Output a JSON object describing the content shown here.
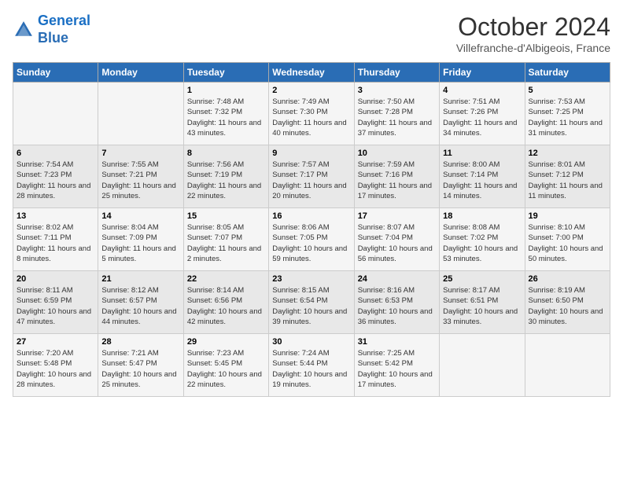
{
  "logo": {
    "line1": "General",
    "line2": "Blue"
  },
  "title": "October 2024",
  "subtitle": "Villefranche-d'Albigeois, France",
  "days_header": [
    "Sunday",
    "Monday",
    "Tuesday",
    "Wednesday",
    "Thursday",
    "Friday",
    "Saturday"
  ],
  "weeks": [
    [
      {
        "day": "",
        "sunrise": "",
        "sunset": "",
        "daylight": ""
      },
      {
        "day": "",
        "sunrise": "",
        "sunset": "",
        "daylight": ""
      },
      {
        "day": "1",
        "sunrise": "Sunrise: 7:48 AM",
        "sunset": "Sunset: 7:32 PM",
        "daylight": "Daylight: 11 hours and 43 minutes."
      },
      {
        "day": "2",
        "sunrise": "Sunrise: 7:49 AM",
        "sunset": "Sunset: 7:30 PM",
        "daylight": "Daylight: 11 hours and 40 minutes."
      },
      {
        "day": "3",
        "sunrise": "Sunrise: 7:50 AM",
        "sunset": "Sunset: 7:28 PM",
        "daylight": "Daylight: 11 hours and 37 minutes."
      },
      {
        "day": "4",
        "sunrise": "Sunrise: 7:51 AM",
        "sunset": "Sunset: 7:26 PM",
        "daylight": "Daylight: 11 hours and 34 minutes."
      },
      {
        "day": "5",
        "sunrise": "Sunrise: 7:53 AM",
        "sunset": "Sunset: 7:25 PM",
        "daylight": "Daylight: 11 hours and 31 minutes."
      }
    ],
    [
      {
        "day": "6",
        "sunrise": "Sunrise: 7:54 AM",
        "sunset": "Sunset: 7:23 PM",
        "daylight": "Daylight: 11 hours and 28 minutes."
      },
      {
        "day": "7",
        "sunrise": "Sunrise: 7:55 AM",
        "sunset": "Sunset: 7:21 PM",
        "daylight": "Daylight: 11 hours and 25 minutes."
      },
      {
        "day": "8",
        "sunrise": "Sunrise: 7:56 AM",
        "sunset": "Sunset: 7:19 PM",
        "daylight": "Daylight: 11 hours and 22 minutes."
      },
      {
        "day": "9",
        "sunrise": "Sunrise: 7:57 AM",
        "sunset": "Sunset: 7:17 PM",
        "daylight": "Daylight: 11 hours and 20 minutes."
      },
      {
        "day": "10",
        "sunrise": "Sunrise: 7:59 AM",
        "sunset": "Sunset: 7:16 PM",
        "daylight": "Daylight: 11 hours and 17 minutes."
      },
      {
        "day": "11",
        "sunrise": "Sunrise: 8:00 AM",
        "sunset": "Sunset: 7:14 PM",
        "daylight": "Daylight: 11 hours and 14 minutes."
      },
      {
        "day": "12",
        "sunrise": "Sunrise: 8:01 AM",
        "sunset": "Sunset: 7:12 PM",
        "daylight": "Daylight: 11 hours and 11 minutes."
      }
    ],
    [
      {
        "day": "13",
        "sunrise": "Sunrise: 8:02 AM",
        "sunset": "Sunset: 7:11 PM",
        "daylight": "Daylight: 11 hours and 8 minutes."
      },
      {
        "day": "14",
        "sunrise": "Sunrise: 8:04 AM",
        "sunset": "Sunset: 7:09 PM",
        "daylight": "Daylight: 11 hours and 5 minutes."
      },
      {
        "day": "15",
        "sunrise": "Sunrise: 8:05 AM",
        "sunset": "Sunset: 7:07 PM",
        "daylight": "Daylight: 11 hours and 2 minutes."
      },
      {
        "day": "16",
        "sunrise": "Sunrise: 8:06 AM",
        "sunset": "Sunset: 7:05 PM",
        "daylight": "Daylight: 10 hours and 59 minutes."
      },
      {
        "day": "17",
        "sunrise": "Sunrise: 8:07 AM",
        "sunset": "Sunset: 7:04 PM",
        "daylight": "Daylight: 10 hours and 56 minutes."
      },
      {
        "day": "18",
        "sunrise": "Sunrise: 8:08 AM",
        "sunset": "Sunset: 7:02 PM",
        "daylight": "Daylight: 10 hours and 53 minutes."
      },
      {
        "day": "19",
        "sunrise": "Sunrise: 8:10 AM",
        "sunset": "Sunset: 7:00 PM",
        "daylight": "Daylight: 10 hours and 50 minutes."
      }
    ],
    [
      {
        "day": "20",
        "sunrise": "Sunrise: 8:11 AM",
        "sunset": "Sunset: 6:59 PM",
        "daylight": "Daylight: 10 hours and 47 minutes."
      },
      {
        "day": "21",
        "sunrise": "Sunrise: 8:12 AM",
        "sunset": "Sunset: 6:57 PM",
        "daylight": "Daylight: 10 hours and 44 minutes."
      },
      {
        "day": "22",
        "sunrise": "Sunrise: 8:14 AM",
        "sunset": "Sunset: 6:56 PM",
        "daylight": "Daylight: 10 hours and 42 minutes."
      },
      {
        "day": "23",
        "sunrise": "Sunrise: 8:15 AM",
        "sunset": "Sunset: 6:54 PM",
        "daylight": "Daylight: 10 hours and 39 minutes."
      },
      {
        "day": "24",
        "sunrise": "Sunrise: 8:16 AM",
        "sunset": "Sunset: 6:53 PM",
        "daylight": "Daylight: 10 hours and 36 minutes."
      },
      {
        "day": "25",
        "sunrise": "Sunrise: 8:17 AM",
        "sunset": "Sunset: 6:51 PM",
        "daylight": "Daylight: 10 hours and 33 minutes."
      },
      {
        "day": "26",
        "sunrise": "Sunrise: 8:19 AM",
        "sunset": "Sunset: 6:50 PM",
        "daylight": "Daylight: 10 hours and 30 minutes."
      }
    ],
    [
      {
        "day": "27",
        "sunrise": "Sunrise: 7:20 AM",
        "sunset": "Sunset: 5:48 PM",
        "daylight": "Daylight: 10 hours and 28 minutes."
      },
      {
        "day": "28",
        "sunrise": "Sunrise: 7:21 AM",
        "sunset": "Sunset: 5:47 PM",
        "daylight": "Daylight: 10 hours and 25 minutes."
      },
      {
        "day": "29",
        "sunrise": "Sunrise: 7:23 AM",
        "sunset": "Sunset: 5:45 PM",
        "daylight": "Daylight: 10 hours and 22 minutes."
      },
      {
        "day": "30",
        "sunrise": "Sunrise: 7:24 AM",
        "sunset": "Sunset: 5:44 PM",
        "daylight": "Daylight: 10 hours and 19 minutes."
      },
      {
        "day": "31",
        "sunrise": "Sunrise: 7:25 AM",
        "sunset": "Sunset: 5:42 PM",
        "daylight": "Daylight: 10 hours and 17 minutes."
      },
      {
        "day": "",
        "sunrise": "",
        "sunset": "",
        "daylight": ""
      },
      {
        "day": "",
        "sunrise": "",
        "sunset": "",
        "daylight": ""
      }
    ]
  ]
}
